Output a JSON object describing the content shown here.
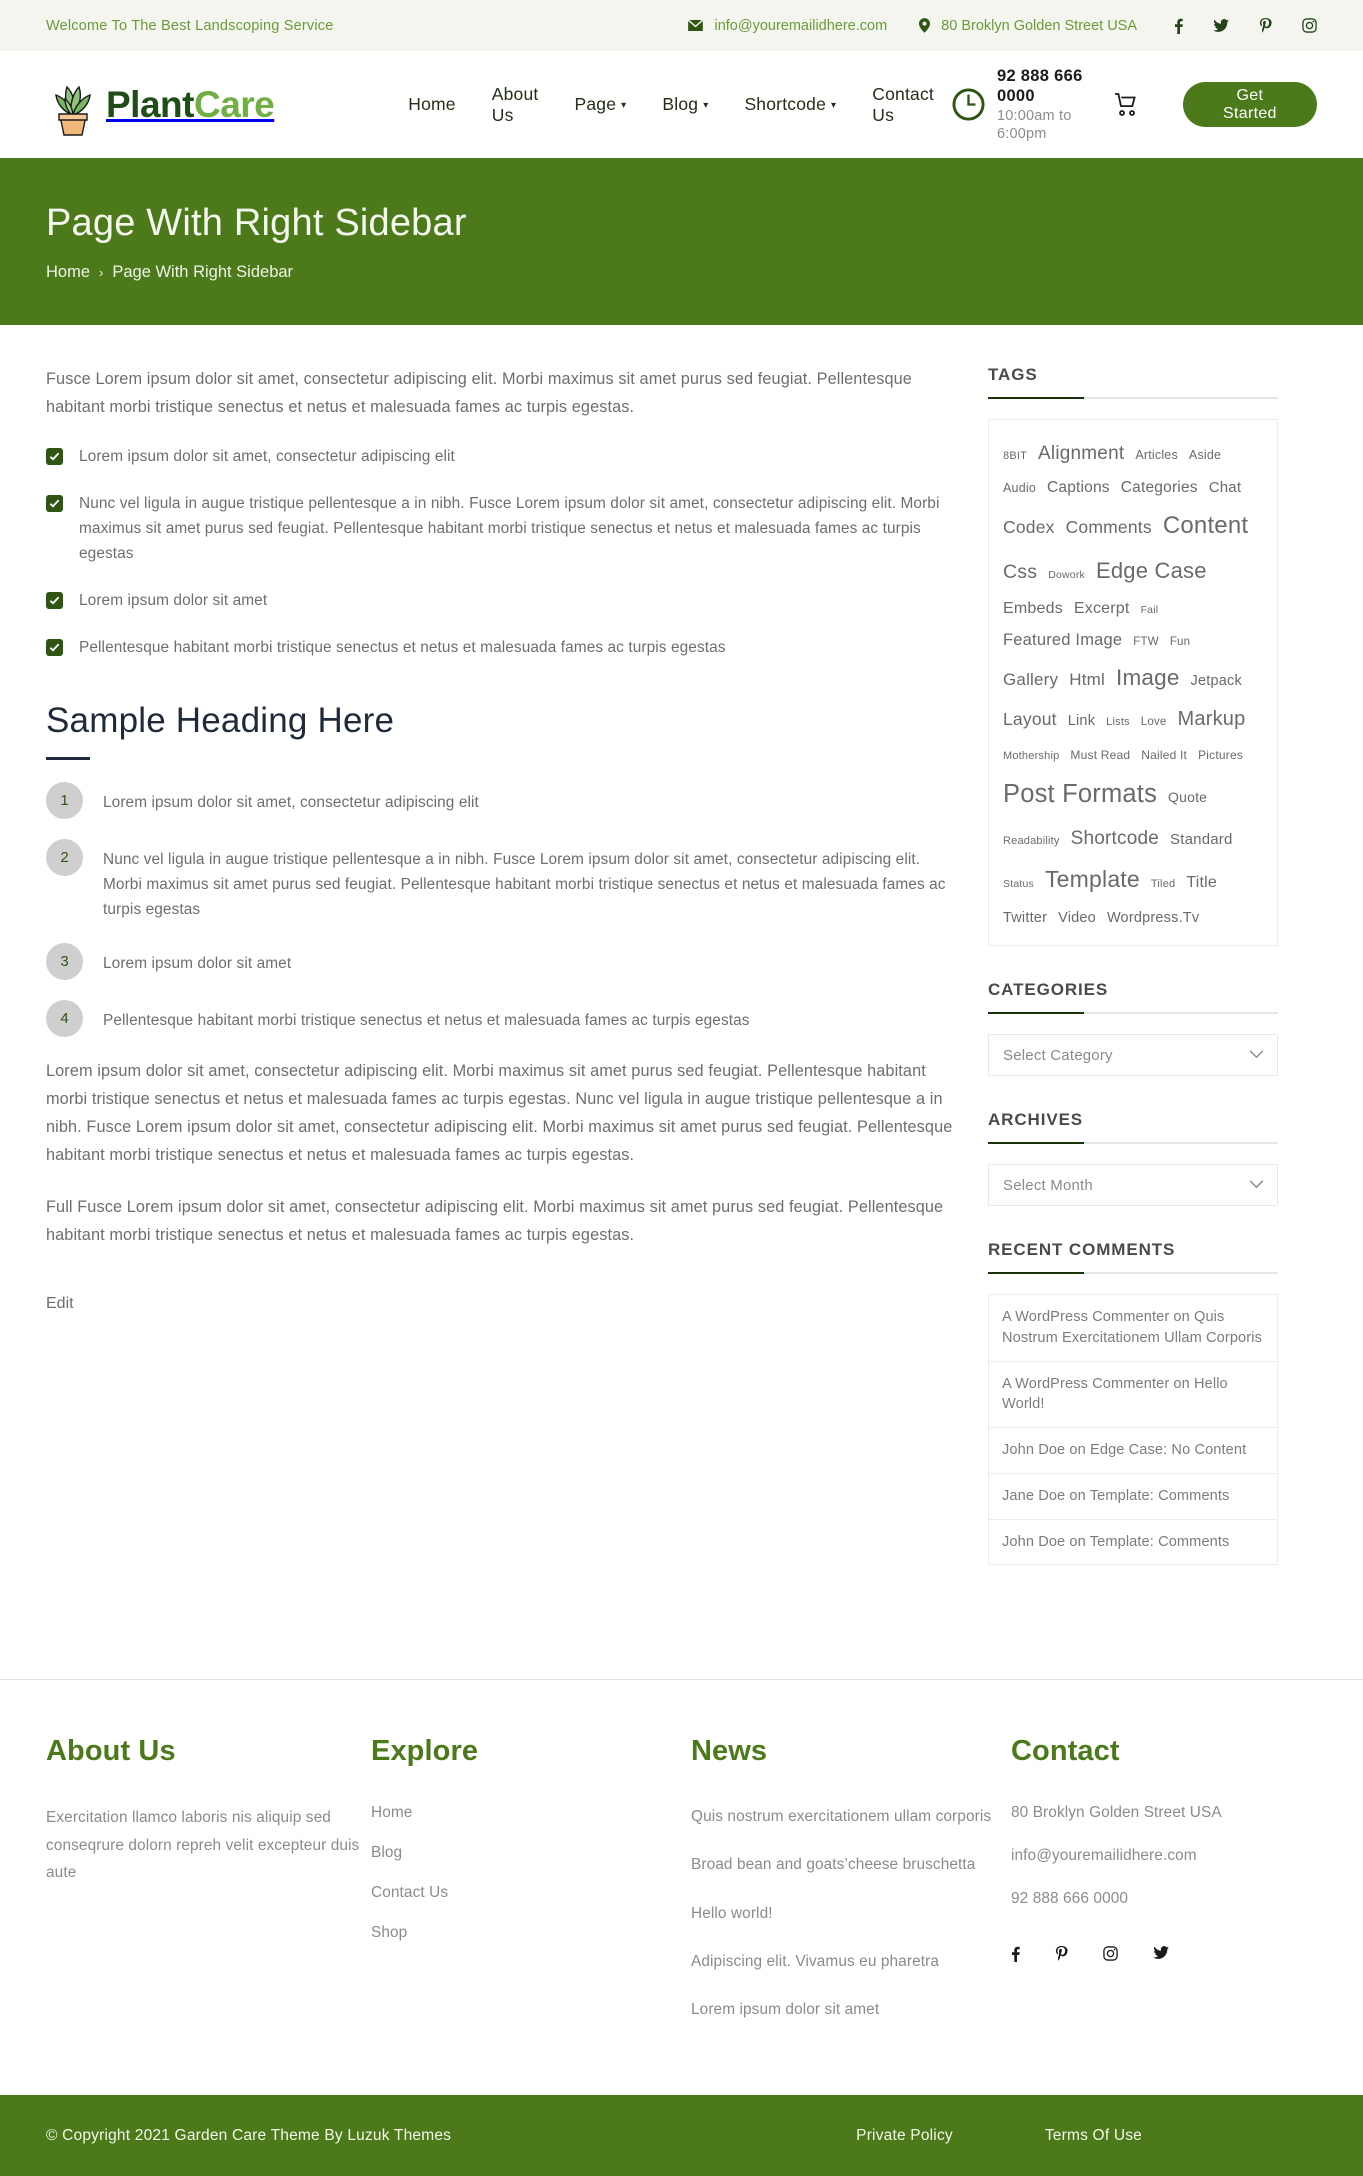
{
  "topbar": {
    "welcome": "Welcome To The Best Landscoping Service",
    "email": "info@youremailidhere.com",
    "address": "80 Broklyn Golden Street USA",
    "social": [
      {
        "name": "facebook-icon",
        "glyph": "f"
      },
      {
        "name": "twitter-icon",
        "glyph": "🐦"
      },
      {
        "name": "pinterest-icon",
        "glyph": "P"
      },
      {
        "name": "instagram-icon",
        "glyph": "▣"
      }
    ]
  },
  "header": {
    "logo_text_1": "Plant",
    "logo_text_2": "Care",
    "nav": [
      {
        "label": "Home",
        "caret": false
      },
      {
        "label": "About Us",
        "caret": false
      },
      {
        "label": "Page",
        "caret": true
      },
      {
        "label": "Blog",
        "caret": true
      },
      {
        "label": "Shortcode",
        "caret": true
      },
      {
        "label": "Contact Us",
        "caret": false
      }
    ],
    "phone": "92 888 666 0000",
    "hours": "10:00am to 6:00pm",
    "cta": "Get Started"
  },
  "hero": {
    "title": "Page With Right Sidebar",
    "crumb_home": "Home",
    "crumb_sep": "›",
    "crumb_current": "Page With Right Sidebar"
  },
  "content": {
    "intro": "Fusce Lorem ipsum dolor sit amet, consectetur adipiscing elit. Morbi maximus sit amet purus sed feugiat. Pellentesque habitant morbi tristique senectus et netus et malesuada fames ac turpis egestas.",
    "checklist": [
      "Lorem ipsum dolor sit amet, consectetur adipiscing elit",
      "Nunc vel ligula in augue tristique pellentesque a in nibh. Fusce Lorem ipsum dolor sit amet, consectetur adipiscing elit. Morbi maximus sit amet purus sed feugiat. Pellentesque habitant morbi tristique senectus et netus et malesuada fames ac turpis egestas",
      "Lorem ipsum dolor sit amet",
      "Pellentesque habitant morbi tristique senectus et netus et malesuada fames ac turpis egestas"
    ],
    "heading": "Sample Heading Here",
    "numbered": [
      {
        "n": "1",
        "text": "Lorem ipsum dolor sit amet, consectetur adipiscing elit"
      },
      {
        "n": "2",
        "text": "Nunc vel ligula in augue tristique pellentesque a in nibh. Fusce Lorem ipsum dolor sit amet, consectetur adipiscing elit. Morbi maximus sit amet purus sed feugiat. Pellentesque habitant morbi tristique senectus et netus et malesuada fames ac turpis egestas"
      },
      {
        "n": "3",
        "text": "Lorem ipsum dolor sit amet"
      },
      {
        "n": "4",
        "text": "Pellentesque habitant morbi tristique senectus et netus et malesuada fames ac turpis egestas"
      }
    ],
    "para2": "Lorem ipsum dolor sit amet, consectetur adipiscing elit. Morbi maximus sit amet purus sed feugiat. Pellentesque habitant morbi tristique senectus et netus et malesuada fames ac turpis egestas. Nunc vel ligula in augue tristique pellentesque a in nibh. Fusce Lorem ipsum dolor sit amet, consectetur adipiscing elit. Morbi maximus sit amet purus sed feugiat. Pellentesque habitant morbi tristique senectus et netus et malesuada fames ac turpis egestas.",
    "para3": "Full Fusce Lorem ipsum dolor sit amet, consectetur adipiscing elit. Morbi maximus sit amet purus sed feugiat. Pellentesque habitant morbi tristique senectus et netus et malesuada fames ac turpis egestas.",
    "edit": "Edit"
  },
  "sidebar": {
    "tags_title": "TAGS",
    "tags": [
      {
        "label": "8BIT",
        "size": 11
      },
      {
        "label": "Alignment",
        "size": 19
      },
      {
        "label": "Articles",
        "size": 12.5
      },
      {
        "label": "Aside",
        "size": 12.5
      },
      {
        "label": "Audio",
        "size": 12.5
      },
      {
        "label": "Captions",
        "size": 15.5
      },
      {
        "label": "Categories",
        "size": 15.5
      },
      {
        "label": "Chat",
        "size": 15
      },
      {
        "label": "Codex",
        "size": 17.5
      },
      {
        "label": "Comments",
        "size": 17.5
      },
      {
        "label": "Content",
        "size": 24
      },
      {
        "label": "Css",
        "size": 19.5
      },
      {
        "label": "Dowork",
        "size": 10.5
      },
      {
        "label": "Edge Case",
        "size": 22
      },
      {
        "label": "Embeds",
        "size": 16
      },
      {
        "label": "Excerpt",
        "size": 16
      },
      {
        "label": "Fail",
        "size": 10.5
      },
      {
        "label": "Featured Image",
        "size": 16.5
      },
      {
        "label": "FTW",
        "size": 11.5
      },
      {
        "label": "Fun",
        "size": 11.5
      },
      {
        "label": "Gallery",
        "size": 17
      },
      {
        "label": "Html",
        "size": 17
      },
      {
        "label": "Image",
        "size": 22.5
      },
      {
        "label": "Jetpack",
        "size": 14.5
      },
      {
        "label": "Layout",
        "size": 17.5
      },
      {
        "label": "Link",
        "size": 14.5
      },
      {
        "label": "Lists",
        "size": 11
      },
      {
        "label": "Love",
        "size": 11.5
      },
      {
        "label": "Markup",
        "size": 20
      },
      {
        "label": "Mothership",
        "size": 11
      },
      {
        "label": "Must Read",
        "size": 12
      },
      {
        "label": "Nailed It",
        "size": 12
      },
      {
        "label": "Pictures",
        "size": 12
      },
      {
        "label": "Post Formats",
        "size": 25.5
      },
      {
        "label": "Quote",
        "size": 14
      },
      {
        "label": "Readability",
        "size": 11
      },
      {
        "label": "Shortcode",
        "size": 19
      },
      {
        "label": "Standard",
        "size": 15
      },
      {
        "label": "Status",
        "size": 10.5
      },
      {
        "label": "Template",
        "size": 23
      },
      {
        "label": "Tiled",
        "size": 11
      },
      {
        "label": "Title",
        "size": 16
      },
      {
        "label": "Twitter",
        "size": 14.5
      },
      {
        "label": "Video",
        "size": 14.5
      },
      {
        "label": "Wordpress.Tv",
        "size": 14.5
      }
    ],
    "categories_title": "CATEGORIES",
    "categories_value": "Select Category",
    "archives_title": "ARCHIVES",
    "archives_value": "Select Month",
    "comments_title": "RECENT COMMENTS",
    "comments": [
      "A WordPress Commenter on Quis Nostrum Exercitationem Ullam Corporis",
      "A WordPress Commenter on Hello World!",
      "John Doe on Edge Case: No Content",
      "Jane Doe on Template: Comments",
      "John Doe on Template: Comments"
    ]
  },
  "footer": {
    "about_title": "About Us",
    "about_text": "Exercitation llamco laboris nis aliquip sed conseqrure dolorn repreh velit excepteur duis aute",
    "explore_title": "Explore",
    "explore_links": [
      "Home",
      "Blog",
      "Contact Us",
      "Shop"
    ],
    "news_title": "News",
    "news_links": [
      "Quis nostrum exercitationem ullam corporis",
      "Broad bean and goats’cheese bruschetta",
      "Hello world!",
      "Adipiscing elit. Vivamus eu pharetra",
      "Lorem ipsum dolor sit amet"
    ],
    "contact_title": "Contact",
    "contact_address": "80 Broklyn Golden Street USA",
    "contact_email": "info@youremailidhere.com",
    "contact_phone": "92 888 666 0000",
    "social": [
      {
        "name": "facebook-icon",
        "glyph": "f"
      },
      {
        "name": "pinterest-icon",
        "glyph": "P"
      },
      {
        "name": "instagram-icon",
        "glyph": "▣"
      },
      {
        "name": "twitter-icon",
        "glyph": "🐦"
      }
    ],
    "copyright": "© Copyright 2021 Garden Care Theme By Luzuk Themes",
    "bottom_links": [
      "Private Policy",
      "Terms Of Use"
    ]
  },
  "colors": {
    "brand_green": "#4c7a1a",
    "light_green": "#6faf44",
    "dark_green": "#1f4d18",
    "topbar_bg": "#f3f5ee"
  }
}
